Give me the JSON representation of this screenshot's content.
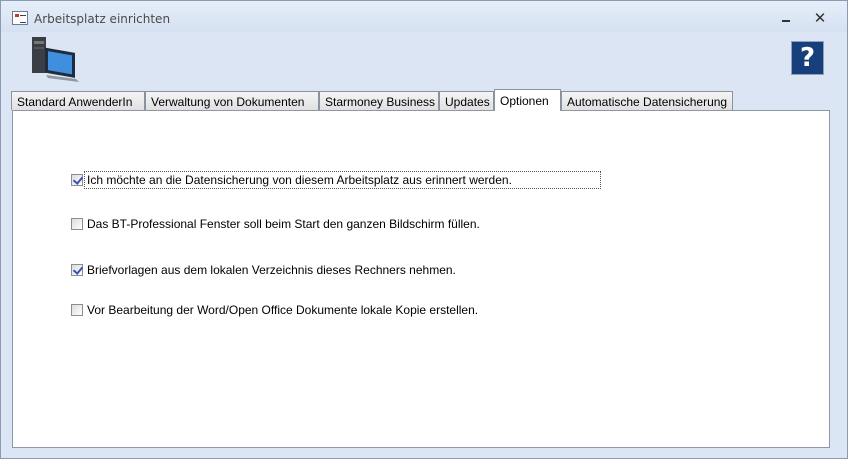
{
  "window": {
    "title": "Arbeitsplatz einrichten",
    "controls": [
      "–",
      "□",
      "✕"
    ]
  },
  "icons": {
    "app": "form-icon",
    "logo": "computer-workstation-icon",
    "help": "help-icon"
  },
  "help": {
    "label": "?"
  },
  "tabs": [
    {
      "label": "Standard AnwenderIn",
      "active": false
    },
    {
      "label": "Verwaltung von Dokumenten",
      "active": false
    },
    {
      "label": "Starmoney Business",
      "active": false
    },
    {
      "label": "Updates",
      "active": false
    },
    {
      "label": "Optionen",
      "active": true
    },
    {
      "label": "Automatische Datensicherung",
      "active": false
    }
  ],
  "options": [
    {
      "label": "Ich möchte an die Datensicherung von diesem Arbeitsplatz aus erinnert werden.",
      "checked": true
    },
    {
      "label": "Das BT-Professional Fenster soll beim Start den ganzen Bildschirm füllen.",
      "checked": false
    },
    {
      "label": "Briefvorlagen aus dem lokalen Verzeichnis dieses Rechners nehmen.",
      "checked": true
    },
    {
      "label": "Vor Bearbeitung der Word/Open Office Dokumente lokale Kopie erstellen.",
      "checked": false
    }
  ],
  "colors": {
    "titlebar": "#dbe5f3",
    "help_bg": "#173f7b",
    "checkmark": "#3b4fb8"
  }
}
